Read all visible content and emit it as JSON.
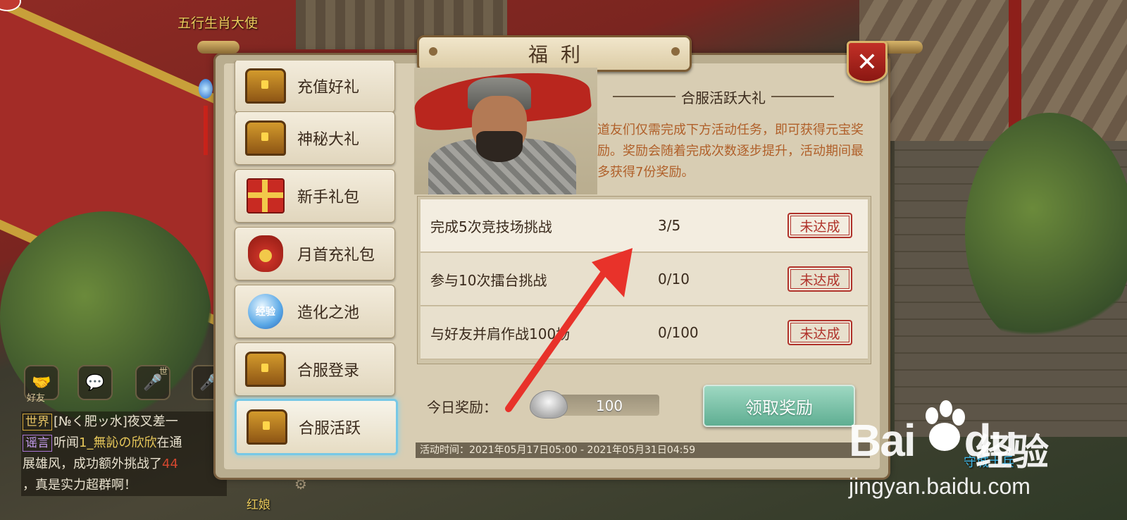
{
  "scene": {
    "npc_top": "五行生肖大使",
    "npc_right": "守城士兵",
    "npc_bottom": "红娘"
  },
  "social": {
    "friend_label": "好友",
    "world_voice_sup": "世"
  },
  "chat": {
    "lines": [
      {
        "tag": "世界",
        "text": "[№く肥ッ水]夜叉差一"
      },
      {
        "tag": "谣言",
        "text_a": "听闻",
        "hl": "1_無訫の欣欣",
        "text_b": "在通"
      },
      {
        "text_a": "展雄风，成功额外挑战了",
        "red": "44"
      },
      {
        "text_a": "，真是实力超群啊！"
      }
    ]
  },
  "panel": {
    "title": "福利",
    "close_label": "✕"
  },
  "menu": {
    "items": [
      {
        "label": "充值好礼",
        "icon": "chest-icon"
      },
      {
        "label": "神秘大礼",
        "icon": "treasure-chest-icon"
      },
      {
        "label": "新手礼包",
        "icon": "gift-box-icon"
      },
      {
        "label": "月首充礼包",
        "icon": "money-bag-icon"
      },
      {
        "label": "造化之池",
        "icon": "exp-orb-icon",
        "icon_text": "经验"
      },
      {
        "label": "合服登录",
        "icon": "chest-icon"
      },
      {
        "label": "合服活跃",
        "icon": "chest-icon",
        "active": true
      }
    ]
  },
  "content": {
    "subtitle": "合服活跃大礼",
    "description": "道友们仅需完成下方活动任务，即可获得元宝奖励。奖励会随着完成次数逐步提升，活动期间最多获得7份奖励。",
    "tasks": [
      {
        "name": "完成5次竞技场挑战",
        "progress": "3/5",
        "status": "未达成"
      },
      {
        "name": "参与10次擂台挑战",
        "progress": "0/10",
        "status": "未达成"
      },
      {
        "name": "与好友并肩作战100场",
        "progress": "0/100",
        "status": "未达成"
      }
    ],
    "today_label": "今日奖励：",
    "reward_value": "100",
    "claim_label": "领取奖励",
    "activity_time": "活动时间：2021年05月17日05:00 - 2021年05月31日04:59"
  },
  "watermark": {
    "logo": "Bai",
    "logo2": "du",
    "cn": "经验",
    "url": "jingyan.baidu.com"
  },
  "colors": {
    "accent_red": "#b0332b",
    "description": "#b0602a",
    "claim_button": "#5fae92",
    "active_border": "#77c8e6",
    "arrow": "#e8322a"
  }
}
